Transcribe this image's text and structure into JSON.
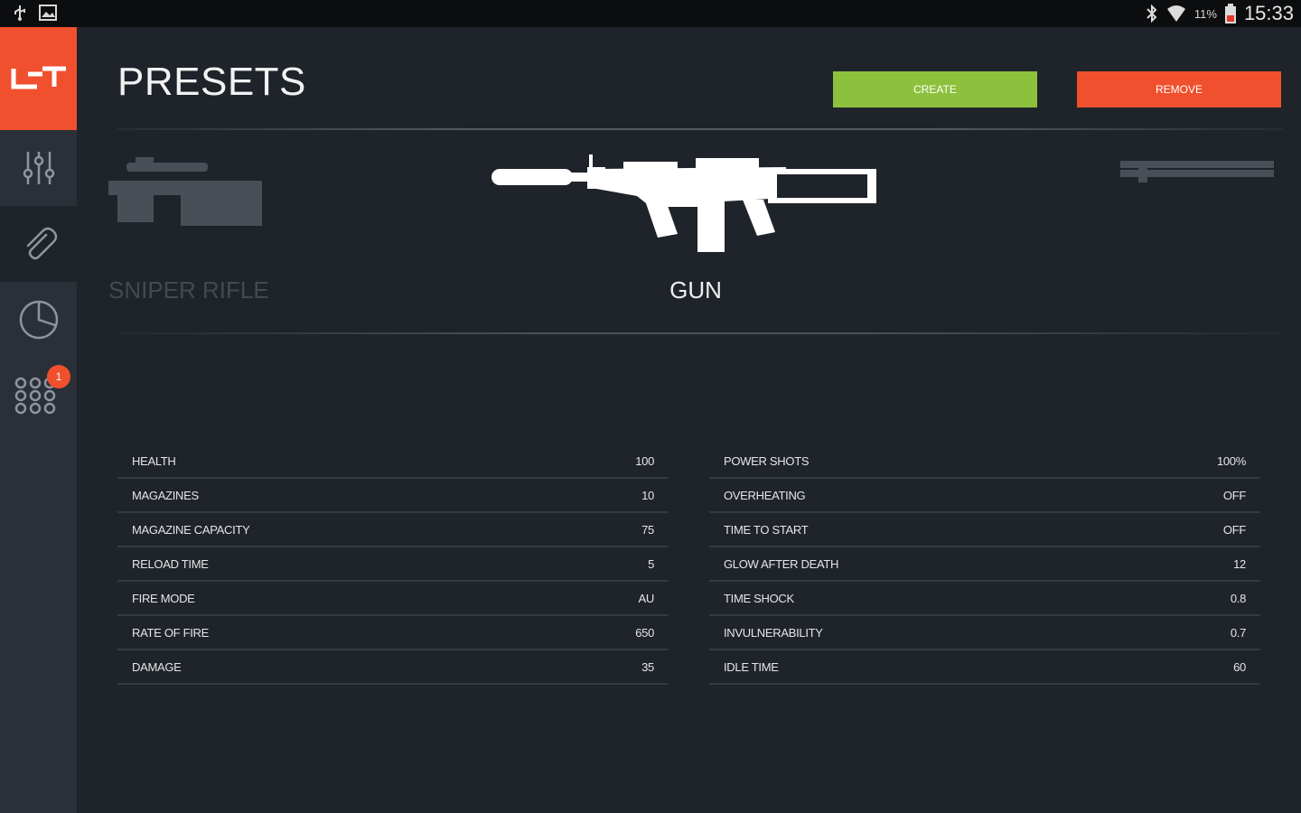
{
  "status_bar": {
    "battery": "11%",
    "time": "15:33"
  },
  "header": {
    "title": "PRESETS",
    "create_label": "CREATE",
    "remove_label": "REMOVE"
  },
  "sidebar": {
    "logo": "LT",
    "items": [
      {
        "icon": "sliders-icon",
        "active": false
      },
      {
        "icon": "paperclip-icon",
        "active": true
      },
      {
        "icon": "pie-chart-icon",
        "active": false
      },
      {
        "icon": "grid-dots-icon",
        "active": false,
        "badge": "1"
      }
    ]
  },
  "carousel": {
    "prev_label": "SNIPER RIFLE",
    "current_label": "GUN"
  },
  "stats_left": [
    {
      "label": "HEALTH",
      "value": "100"
    },
    {
      "label": "MAGAZINES",
      "value": "10"
    },
    {
      "label": "MAGAZINE CAPACITY",
      "value": "75"
    },
    {
      "label": "RELOAD TIME",
      "value": "5"
    },
    {
      "label": "FIRE MODE",
      "value": "AU"
    },
    {
      "label": "RATE OF FIRE",
      "value": "650"
    },
    {
      "label": "DAMAGE",
      "value": "35"
    }
  ],
  "stats_right": [
    {
      "label": "POWER SHOTS",
      "value": "100%"
    },
    {
      "label": "OVERHEATING",
      "value": "OFF"
    },
    {
      "label": "TIME TO START",
      "value": "OFF"
    },
    {
      "label": "GLOW AFTER DEATH",
      "value": "12"
    },
    {
      "label": "TIME SHOCK",
      "value": "0.8"
    },
    {
      "label": "INVULNERABILITY",
      "value": "0.7"
    },
    {
      "label": "IDLE TIME",
      "value": "60"
    }
  ],
  "colors": {
    "accent": "#f0502d",
    "create": "#8dc13d",
    "background": "#1f232a",
    "sidebar": "#2b3038"
  }
}
